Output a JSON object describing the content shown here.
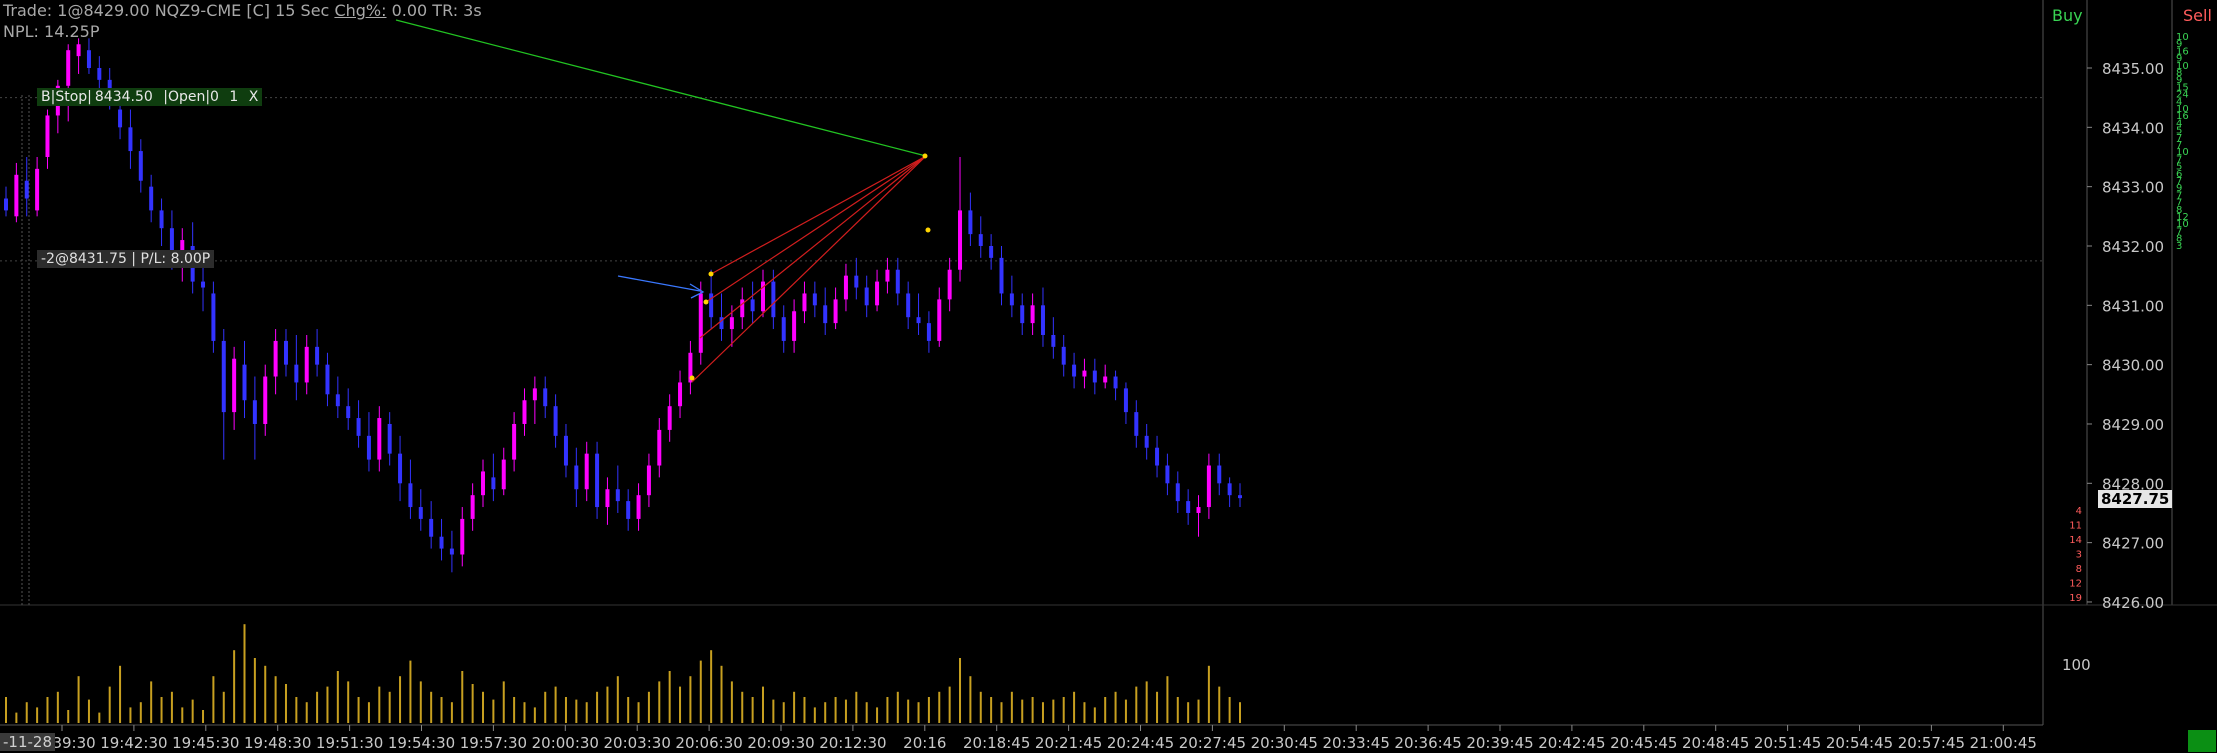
{
  "header": {
    "line1_prefix": "Trade: 1@8429.00  NQZ9-CME [C] 15 Sec",
    "chg_label": "Chg%:",
    "line1_suffix": " 0.00 TR: 3s",
    "npl": "NPL: 14.25P"
  },
  "order_tag": {
    "side": "B|Stop|",
    "price": "8434.50",
    "status": "|Open|0",
    "qty": "1",
    "close": "X"
  },
  "position_tag": "-2@8431.75 | P/L: 8.00P",
  "dom": {
    "buy_label": "Buy",
    "sell_label": "Sell",
    "sell_sizes": [
      "10",
      "9",
      "16",
      "9",
      "10",
      "8",
      "9",
      "15",
      "24",
      "4",
      "10",
      "16",
      "4",
      "5",
      "7",
      "7",
      "10",
      "7",
      "5",
      "6",
      "7",
      "9",
      "7",
      "7",
      "8",
      "12",
      "10",
      "7",
      "8",
      "3"
    ],
    "buy_sizes": [
      "4",
      "11",
      "14",
      "3",
      "8",
      "12",
      "19"
    ]
  },
  "price_axis": {
    "levels": [
      "8435.00",
      "8434.00",
      "8433.00",
      "8432.00",
      "8431.00",
      "8430.00",
      "8429.00",
      "8428.00",
      "8427.00",
      "8426.00"
    ],
    "current_price": "8427.75"
  },
  "volume_axis": {
    "label": "100"
  },
  "time_axis": {
    "first_label": "-11-28",
    "labels": [
      "19:39:30",
      "19:42:30",
      "19:45:30",
      "19:48:30",
      "19:51:30",
      "19:54:30",
      "19:57:30",
      "20:00:30",
      "20:03:30",
      "20:06:30",
      "20:09:30",
      "20:12:30",
      "20:16",
      "20:18:45",
      "20:21:45",
      "20:24:45",
      "20:27:45",
      "20:30:45",
      "20:33:45",
      "20:36:45",
      "20:39:45",
      "20:42:45",
      "20:45:45",
      "20:48:45",
      "20:51:45",
      "20:54:45",
      "20:57:45",
      "21:00:45"
    ]
  },
  "colors": {
    "up_bar": "#ff00ff",
    "down_bar": "#3333ff",
    "volume": "#c8a020",
    "buy": "#39d353",
    "sell": "#ff5c5c",
    "trendline_green": "#22c322",
    "fan_red": "#d21e1e",
    "arrow_blue": "#3a78ff"
  },
  "chart_data": {
    "type": "ohlc",
    "timeframe": "15 Sec",
    "symbol": "NQZ9-CME",
    "ylim": [
      8426.0,
      8435.5
    ],
    "bars": [
      [
        8432.8,
        8433.0,
        8432.5,
        8432.6
      ],
      [
        8432.5,
        8433.4,
        8432.4,
        8433.2
      ],
      [
        8433.1,
        8433.5,
        8432.5,
        8432.8
      ],
      [
        8432.6,
        8433.5,
        8432.5,
        8433.3
      ],
      [
        8433.5,
        8434.3,
        8433.3,
        8434.2
      ],
      [
        8434.2,
        8434.8,
        8433.9,
        8434.7
      ],
      [
        8434.7,
        8435.4,
        8434.1,
        8435.3
      ],
      [
        8435.2,
        8435.5,
        8434.9,
        8435.4
      ],
      [
        8435.3,
        8435.5,
        8434.9,
        8435.0
      ],
      [
        8435.0,
        8435.2,
        8434.6,
        8434.8
      ],
      [
        8434.8,
        8435.0,
        8434.3,
        8434.4
      ],
      [
        8434.3,
        8434.6,
        8433.8,
        8434.0
      ],
      [
        8434.0,
        8434.3,
        8433.3,
        8433.6
      ],
      [
        8433.6,
        8433.8,
        8432.9,
        8433.1
      ],
      [
        8433.0,
        8433.2,
        8432.4,
        8432.6
      ],
      [
        8432.6,
        8432.8,
        8432.0,
        8432.3
      ],
      [
        8432.3,
        8432.6,
        8431.6,
        8431.8
      ],
      [
        8431.8,
        8432.3,
        8431.4,
        8432.1
      ],
      [
        8432.0,
        8432.4,
        8431.2,
        8431.4
      ],
      [
        8431.4,
        8431.8,
        8430.9,
        8431.3
      ],
      [
        8431.2,
        8431.4,
        8430.2,
        8430.4
      ],
      [
        8430.4,
        8430.6,
        8428.4,
        8429.2
      ],
      [
        8429.2,
        8430.3,
        8428.9,
        8430.1
      ],
      [
        8430.0,
        8430.4,
        8429.1,
        8429.4
      ],
      [
        8429.4,
        8429.8,
        8428.4,
        8429.0
      ],
      [
        8429.0,
        8430.0,
        8428.8,
        8429.8
      ],
      [
        8429.8,
        8430.6,
        8429.5,
        8430.4
      ],
      [
        8430.4,
        8430.6,
        8429.8,
        8430.0
      ],
      [
        8430.0,
        8430.5,
        8429.4,
        8429.7
      ],
      [
        8429.7,
        8430.5,
        8429.5,
        8430.3
      ],
      [
        8430.3,
        8430.6,
        8429.8,
        8430.0
      ],
      [
        8430.0,
        8430.2,
        8429.3,
        8429.5
      ],
      [
        8429.5,
        8429.8,
        8429.1,
        8429.3
      ],
      [
        8429.3,
        8429.6,
        8428.9,
        8429.1
      ],
      [
        8429.1,
        8429.4,
        8428.6,
        8428.8
      ],
      [
        8428.8,
        8429.2,
        8428.2,
        8428.4
      ],
      [
        8428.4,
        8429.3,
        8428.2,
        8429.1
      ],
      [
        8429.0,
        8429.2,
        8428.3,
        8428.5
      ],
      [
        8428.5,
        8428.8,
        8427.7,
        8428.0
      ],
      [
        8428.0,
        8428.4,
        8427.4,
        8427.6
      ],
      [
        8427.6,
        8427.9,
        8427.2,
        8427.4
      ],
      [
        8427.4,
        8427.7,
        8426.9,
        8427.1
      ],
      [
        8427.1,
        8427.4,
        8426.7,
        8426.9
      ],
      [
        8426.9,
        8427.2,
        8426.5,
        8426.8
      ],
      [
        8426.8,
        8427.6,
        8426.6,
        8427.4
      ],
      [
        8427.4,
        8428.0,
        8427.2,
        8427.8
      ],
      [
        8427.8,
        8428.4,
        8427.6,
        8428.2
      ],
      [
        8428.1,
        8428.5,
        8427.7,
        8427.9
      ],
      [
        8427.9,
        8428.6,
        8427.8,
        8428.4
      ],
      [
        8428.4,
        8429.2,
        8428.2,
        8429.0
      ],
      [
        8429.0,
        8429.6,
        8428.8,
        8429.4
      ],
      [
        8429.4,
        8429.8,
        8429.0,
        8429.6
      ],
      [
        8429.6,
        8429.8,
        8429.1,
        8429.3
      ],
      [
        8429.3,
        8429.5,
        8428.6,
        8428.8
      ],
      [
        8428.8,
        8429.0,
        8428.1,
        8428.3
      ],
      [
        8428.3,
        8428.6,
        8427.6,
        8427.9
      ],
      [
        8427.9,
        8428.7,
        8427.7,
        8428.5
      ],
      [
        8428.5,
        8428.7,
        8427.4,
        8427.6
      ],
      [
        8427.6,
        8428.1,
        8427.3,
        8427.9
      ],
      [
        8427.9,
        8428.3,
        8427.5,
        8427.7
      ],
      [
        8427.7,
        8427.9,
        8427.2,
        8427.4
      ],
      [
        8427.4,
        8428.0,
        8427.2,
        8427.8
      ],
      [
        8427.8,
        8428.5,
        8427.6,
        8428.3
      ],
      [
        8428.3,
        8429.1,
        8428.1,
        8428.9
      ],
      [
        8428.9,
        8429.5,
        8428.7,
        8429.3
      ],
      [
        8429.3,
        8429.9,
        8429.1,
        8429.7
      ],
      [
        8429.7,
        8430.4,
        8429.5,
        8430.2
      ],
      [
        8430.2,
        8431.4,
        8430.0,
        8431.2
      ],
      [
        8431.2,
        8431.6,
        8430.6,
        8430.8
      ],
      [
        8430.8,
        8431.2,
        8430.4,
        8430.6
      ],
      [
        8430.6,
        8431.0,
        8430.3,
        8430.8
      ],
      [
        8430.8,
        8431.3,
        8430.6,
        8431.1
      ],
      [
        8431.1,
        8431.4,
        8430.7,
        8430.9
      ],
      [
        8430.9,
        8431.6,
        8430.8,
        8431.4
      ],
      [
        8431.4,
        8431.6,
        8430.6,
        8430.8
      ],
      [
        8430.8,
        8431.0,
        8430.2,
        8430.4
      ],
      [
        8430.4,
        8431.1,
        8430.2,
        8430.9
      ],
      [
        8430.9,
        8431.4,
        8430.7,
        8431.2
      ],
      [
        8431.2,
        8431.4,
        8430.8,
        8431.0
      ],
      [
        8431.0,
        8431.3,
        8430.5,
        8430.7
      ],
      [
        8430.7,
        8431.3,
        8430.6,
        8431.1
      ],
      [
        8431.1,
        8431.7,
        8430.9,
        8431.5
      ],
      [
        8431.5,
        8431.8,
        8431.1,
        8431.3
      ],
      [
        8431.3,
        8431.5,
        8430.8,
        8431.0
      ],
      [
        8431.0,
        8431.6,
        8430.9,
        8431.4
      ],
      [
        8431.4,
        8431.8,
        8431.2,
        8431.6
      ],
      [
        8431.6,
        8431.8,
        8431.0,
        8431.2
      ],
      [
        8431.2,
        8431.4,
        8430.6,
        8430.8
      ],
      [
        8430.8,
        8431.2,
        8430.5,
        8430.7
      ],
      [
        8430.7,
        8430.9,
        8430.2,
        8430.4
      ],
      [
        8430.4,
        8431.3,
        8430.3,
        8431.1
      ],
      [
        8431.1,
        8431.8,
        8430.9,
        8431.6
      ],
      [
        8431.6,
        8433.5,
        8431.4,
        8432.6
      ],
      [
        8432.6,
        8432.9,
        8432.0,
        8432.2
      ],
      [
        8432.2,
        8432.5,
        8431.8,
        8432.0
      ],
      [
        8432.0,
        8432.2,
        8431.6,
        8431.8
      ],
      [
        8431.8,
        8432.0,
        8431.0,
        8431.2
      ],
      [
        8431.2,
        8431.5,
        8430.8,
        8431.0
      ],
      [
        8431.0,
        8431.2,
        8430.5,
        8430.7
      ],
      [
        8430.7,
        8431.2,
        8430.5,
        8431.0
      ],
      [
        8431.0,
        8431.3,
        8430.3,
        8430.5
      ],
      [
        8430.5,
        8430.8,
        8430.1,
        8430.3
      ],
      [
        8430.3,
        8430.5,
        8429.8,
        8430.0
      ],
      [
        8430.0,
        8430.2,
        8429.6,
        8429.8
      ],
      [
        8429.8,
        8430.1,
        8429.6,
        8429.9
      ],
      [
        8429.9,
        8430.1,
        8429.5,
        8429.7
      ],
      [
        8429.7,
        8430.0,
        8429.6,
        8429.8
      ],
      [
        8429.8,
        8429.9,
        8429.4,
        8429.6
      ],
      [
        8429.6,
        8429.7,
        8429.0,
        8429.2
      ],
      [
        8429.2,
        8429.4,
        8428.6,
        8428.8
      ],
      [
        8428.8,
        8429.0,
        8428.4,
        8428.6
      ],
      [
        8428.6,
        8428.8,
        8428.1,
        8428.3
      ],
      [
        8428.3,
        8428.5,
        8427.8,
        8428.0
      ],
      [
        8428.0,
        8428.2,
        8427.5,
        8427.7
      ],
      [
        8427.7,
        8427.9,
        8427.3,
        8427.5
      ],
      [
        8427.5,
        8427.8,
        8427.1,
        8427.6
      ],
      [
        8427.6,
        8428.5,
        8427.4,
        8428.3
      ],
      [
        8428.3,
        8428.5,
        8427.8,
        8428.0
      ],
      [
        8428.0,
        8428.1,
        8427.6,
        8427.8
      ],
      [
        8427.8,
        8428.0,
        8427.6,
        8427.75
      ]
    ],
    "volume": [
      10,
      4,
      8,
      6,
      10,
      12,
      5,
      18,
      9,
      4,
      14,
      22,
      6,
      8,
      16,
      10,
      12,
      6,
      9,
      5,
      18,
      12,
      28,
      38,
      25,
      22,
      18,
      15,
      10,
      8,
      12,
      14,
      20,
      16,
      10,
      8,
      14,
      12,
      18,
      24,
      16,
      12,
      10,
      8,
      20,
      15,
      12,
      9,
      16,
      10,
      8,
      6,
      12,
      14,
      10,
      9,
      8,
      12,
      14,
      18,
      10,
      8,
      12,
      16,
      20,
      14,
      18,
      24,
      28,
      22,
      16,
      12,
      10,
      14,
      9,
      8,
      12,
      10,
      6,
      8,
      10,
      9,
      12,
      8,
      6,
      10,
      12,
      9,
      8,
      10,
      12,
      14,
      25,
      18,
      12,
      10,
      8,
      12,
      9,
      10,
      8,
      9,
      10,
      12,
      8,
      6,
      10,
      12,
      9,
      14,
      16,
      12,
      18,
      10,
      8,
      9,
      22,
      14,
      10,
      8
    ],
    "horizontal_levels": [
      8434.5,
      8431.75
    ],
    "annotations": [
      "Buy stop order at 8434.50",
      "Short position -2@8431.75",
      "Green trendline",
      "Red fan lines",
      "Blue arrow"
    ]
  }
}
